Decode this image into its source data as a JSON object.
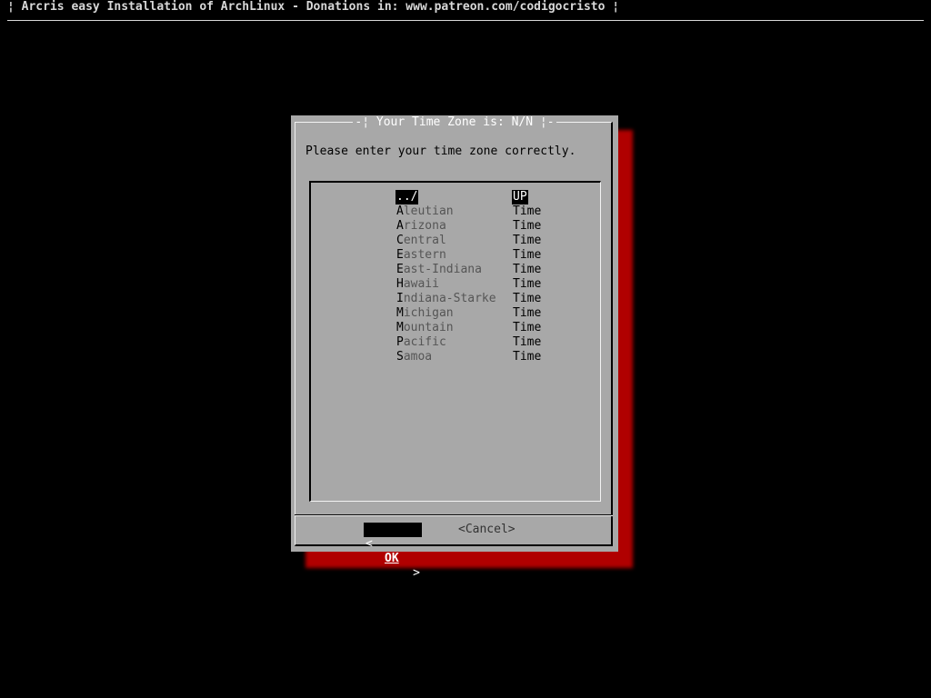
{
  "backtitle": "¦ Arcris easy Installation of ArchLinux - Donations in: www.patreon.com/codigocristo ¦",
  "dialog": {
    "title": "-¦ Your Time Zone is: N/N ¦-",
    "prompt": "Please enter your time zone correctly.",
    "items": [
      {
        "name": "../",
        "desc": "UP",
        "selected": true
      },
      {
        "name": "Aleutian",
        "desc": "Time"
      },
      {
        "name": "Arizona",
        "desc": "Time"
      },
      {
        "name": "Central",
        "desc": "Time"
      },
      {
        "name": "Eastern",
        "desc": "Time"
      },
      {
        "name": "East-Indiana",
        "desc": "Time"
      },
      {
        "name": "Hawaii",
        "desc": "Time"
      },
      {
        "name": "Indiana-Starke",
        "desc": "Time"
      },
      {
        "name": "Michigan",
        "desc": "Time"
      },
      {
        "name": "Mountain",
        "desc": "Time"
      },
      {
        "name": "Pacific",
        "desc": "Time"
      },
      {
        "name": "Samoa",
        "desc": "Time"
      }
    ],
    "buttons": {
      "ok_left": "<",
      "ok_label": "OK",
      "ok_right": ">",
      "cancel": "<Cancel>"
    }
  },
  "colors": {
    "background": "#000000",
    "dialog": "#a8a8a8",
    "shadow": "#b00000"
  }
}
